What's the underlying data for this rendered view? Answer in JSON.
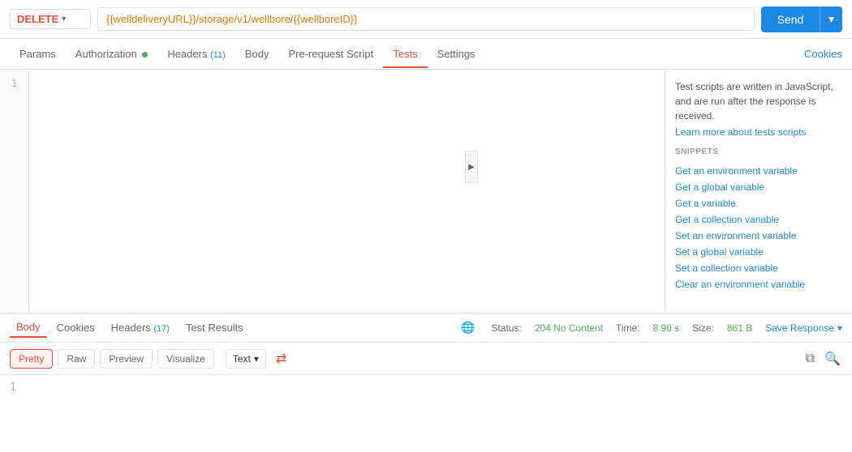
{
  "method": {
    "label": "DELETE",
    "dropdown_arrow": "▾"
  },
  "url": "{{welldeliveryURL}}/storage/v1/wellbore/{{wellboreID}}",
  "send_button": "Send",
  "nav": {
    "tabs": [
      {
        "id": "params",
        "label": "Params",
        "active": false,
        "badge": null,
        "dot": false
      },
      {
        "id": "authorization",
        "label": "Authorization",
        "active": false,
        "badge": null,
        "dot": true
      },
      {
        "id": "headers",
        "label": "Headers",
        "active": false,
        "badge": "(11)",
        "dot": false
      },
      {
        "id": "body",
        "label": "Body",
        "active": false,
        "badge": null,
        "dot": false
      },
      {
        "id": "pre-request-script",
        "label": "Pre-request Script",
        "active": false,
        "badge": null,
        "dot": false
      },
      {
        "id": "tests",
        "label": "Tests",
        "active": true,
        "badge": null,
        "dot": false
      },
      {
        "id": "settings",
        "label": "Settings",
        "active": false,
        "badge": null,
        "dot": false
      }
    ],
    "cookies": "Cookies"
  },
  "snippets_panel": {
    "info_text": "Test scripts are written in JavaScript, and are run after the response is received.",
    "info_link": "Learn more about tests scripts",
    "snippets_label": "SNIPPETS",
    "items": [
      "Get an environment variable",
      "Get a global variable",
      "Get a variable",
      "Get a collection variable",
      "Set an environment variable",
      "Set a global variable",
      "Set a collection variable",
      "Clear an environment variable"
    ]
  },
  "response": {
    "tabs": [
      {
        "id": "body",
        "label": "Body",
        "active": true
      },
      {
        "id": "cookies",
        "label": "Cookies",
        "active": false
      },
      {
        "id": "headers",
        "label": "Headers",
        "badge": "(17)",
        "active": false
      },
      {
        "id": "test-results",
        "label": "Test Results",
        "active": false
      }
    ],
    "status_label": "Status:",
    "status_value": "204 No Content",
    "time_label": "Time:",
    "time_value": "8.90 s",
    "size_label": "Size:",
    "size_value": "861 B",
    "save_response": "Save Response"
  },
  "body_toolbar": {
    "formats": [
      {
        "label": "Pretty",
        "active": true
      },
      {
        "label": "Raw",
        "active": false
      },
      {
        "label": "Preview",
        "active": false
      },
      {
        "label": "Visualize",
        "active": false
      }
    ],
    "text_dropdown": "Text",
    "text_dropdown_arrow": "▾",
    "wrap_icon": "⇄"
  },
  "response_content": {
    "line1": "1"
  }
}
